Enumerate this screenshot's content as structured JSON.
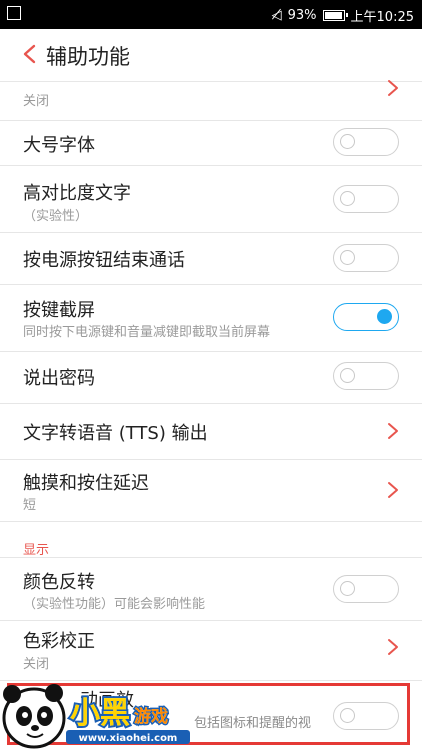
{
  "status": {
    "battery": "93%",
    "time": "上午10:25"
  },
  "header": {
    "title": "辅助功能"
  },
  "items": {
    "partial_sub": "关闭",
    "large_font": "大号字体",
    "high_contrast": "高对比度文字",
    "high_contrast_sub": "（实验性）",
    "power_end_call": "按电源按钮结束通话",
    "key_screenshot": "按键截屏",
    "key_screenshot_sub": "同时按下电源键和音量减键即截取当前屏幕",
    "speak_password": "说出密码",
    "tts": "文字转语音 (TTS) 输出",
    "touch_delay": "触摸和按住延迟",
    "touch_delay_sub": "短",
    "section_display": "显示",
    "color_invert": "颜色反转",
    "color_invert_sub": "（实验性功能）可能会影响性能",
    "color_correct": "色彩校正",
    "color_correct_sub": "关闭",
    "animation_partial": "动画效",
    "animation_sub_partial": "包括图标和提醒的视"
  },
  "toggles": {
    "large_font": false,
    "high_contrast": false,
    "power_end_call": false,
    "key_screenshot": true,
    "speak_password": false,
    "color_invert": false,
    "animation": false
  },
  "watermark": {
    "brand": "小黑游戏",
    "url": "www.xiaohei.com"
  },
  "colors": {
    "accent": "#1ea8f0",
    "section": "#e8554e",
    "highlight_box": "#e53935",
    "back_arrow": "#e8554e"
  }
}
